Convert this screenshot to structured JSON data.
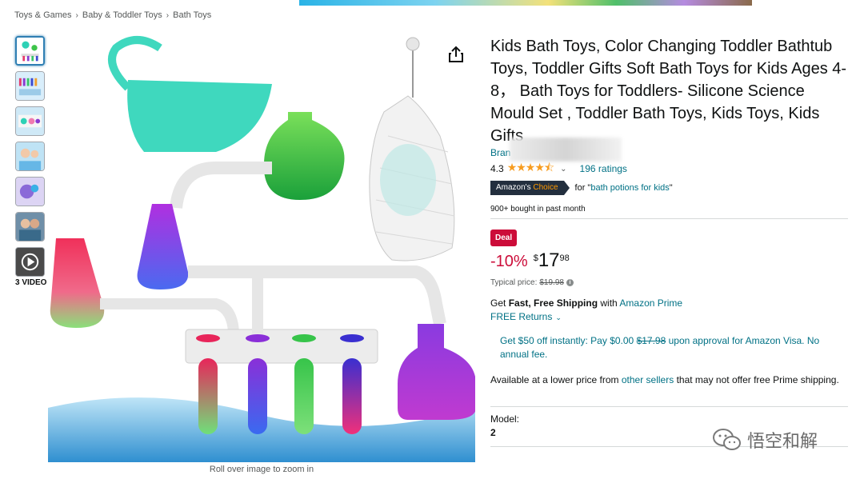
{
  "breadcrumb": [
    "Toys & Games",
    "Baby & Toddler Toys",
    "Bath Toys"
  ],
  "gallery": {
    "thumb_count": 7,
    "video_label": "3 VIDEO",
    "zoom_hint": "Roll over image to zoom in"
  },
  "product": {
    "title": "Kids Bath Toys, Color Changing Toddler Bathtub Toys, Toddler Gifts Soft Bath Toys for Kids Ages 4-8， Bath Toys for Toddlers- Silicone Science Mould Set , Toddler Bath Toys, Kids Toys, Kids Gifts",
    "brand_prefix": "Bran",
    "rating": "4.3",
    "stars": "★★★★⯪",
    "ratings_count": "196 ratings",
    "choice_amazons": "Amazon's",
    "choice_word": "Choice",
    "choice_for": "for \"",
    "choice_keyword": "bath potions for kids",
    "choice_end": "\"",
    "bought": "900+ bought in past month"
  },
  "price": {
    "deal_label": "Deal",
    "discount": "-10%",
    "currency": "$",
    "whole": "17",
    "fraction": "98",
    "typical_label": "Typical price:",
    "typical_value": "$19.98"
  },
  "shipping": {
    "get": "Get ",
    "fast_free": "Fast, Free Shipping",
    "with": " with ",
    "prime": "Amazon Prime",
    "returns": "FREE Returns"
  },
  "promo": {
    "text_a": "Get $50 off instantly: Pay $0.00 ",
    "struck": "$17.98",
    "text_b": " upon approval for Amazon Visa. No annual fee."
  },
  "other_sellers": {
    "text_a": "Available at a lower price from ",
    "link": "other sellers",
    "text_b": " that may not offer free Prime shipping."
  },
  "model": {
    "label": "Model:",
    "value": "2"
  },
  "watermark": {
    "text": "悟空和解"
  },
  "colors": {
    "link": "#007185",
    "deal_red": "#cc0c39",
    "star": "#f79c1f",
    "badge_dark": "#232f3e",
    "badge_orange": "#ff9900"
  }
}
